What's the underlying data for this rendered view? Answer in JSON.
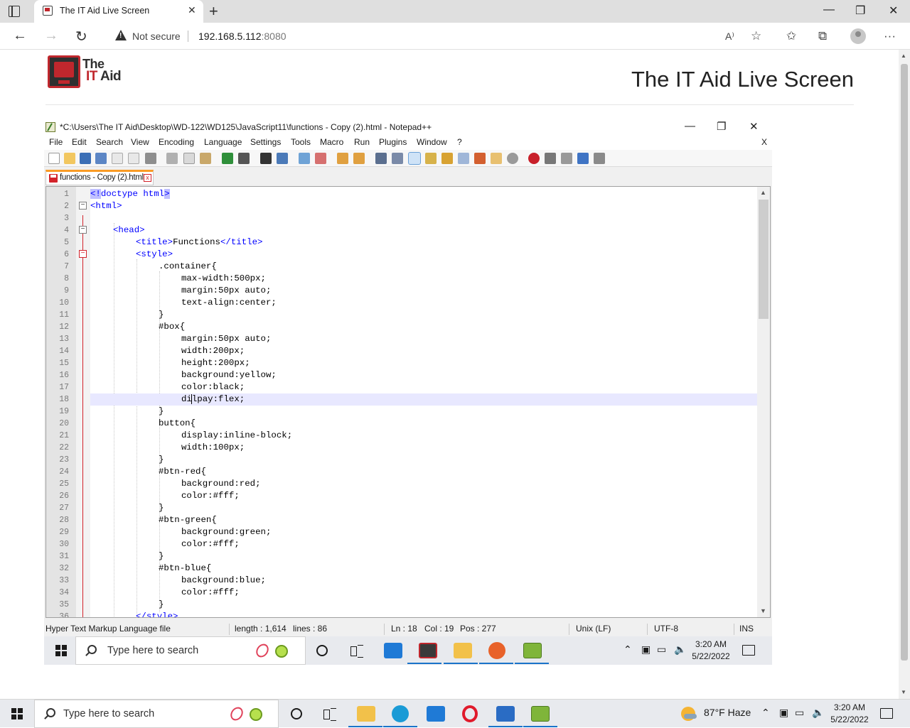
{
  "browser": {
    "tab_title": "The IT Aid Live Screen",
    "tab_close": "✕",
    "new_tab": "+",
    "not_secure": "Not secure",
    "url_host": "192.168.5.112",
    "url_port": ":8080",
    "minimize": "—",
    "restore": "❐",
    "close": "✕"
  },
  "page": {
    "logo_line1": "The",
    "logo_line2_a": "IT",
    "logo_line2_b": "Aid",
    "heading": "The IT Aid Live Screen"
  },
  "npp": {
    "title": "*C:\\Users\\The IT Aid\\Desktop\\WD-122\\WD125\\JavaScript11\\functions - Copy (2).html - Notepad++",
    "window_min": "—",
    "window_restore": "❐",
    "window_close": "✕",
    "menu": [
      "File",
      "Edit",
      "Search",
      "View",
      "Encoding",
      "Language",
      "Settings",
      "Tools",
      "Macro",
      "Run",
      "Plugins",
      "Window",
      "?"
    ],
    "menu_close": "X",
    "doc_tab": "functions - Copy (2).html",
    "doc_tab_close": "x",
    "status": {
      "file_type": "Hyper Text Markup Language file",
      "length": "length : 1,614",
      "lines": "lines : 86",
      "ln": "Ln : 18",
      "col": "Col : 19",
      "pos": "Pos : 277",
      "eol": "Unix (LF)",
      "encoding": "UTF-8",
      "mode": "INS"
    }
  },
  "code": {
    "line_numbers": [
      "1",
      "2",
      "3",
      "4",
      "5",
      "6",
      "7",
      "8",
      "9",
      "10",
      "11",
      "12",
      "13",
      "14",
      "15",
      "16",
      "17",
      "18",
      "19",
      "20",
      "21",
      "22",
      "23",
      "24",
      "25",
      "26",
      "27",
      "28",
      "29",
      "30",
      "31",
      "32",
      "33",
      "34",
      "35",
      "36"
    ],
    "l1_a": "<!",
    "l1_b": "doctype html",
    "l1_c": ">",
    "l2": "<html>",
    "l4": "<head>",
    "l5_a": "<title>",
    "l5_b": "Functions",
    "l5_c": "</title>",
    "l6": "<style>",
    "l7": ".container{",
    "l8": "max-width:500px;",
    "l9": "margin:50px auto;",
    "l10": "text-align:center;",
    "l11": "}",
    "l12": "#box{",
    "l13": "margin:50px auto;",
    "l14": "width:200px;",
    "l15": "height:200px;",
    "l16": "background:yellow;",
    "l17": "color:black;",
    "l18_a": "di",
    "l18_b": "lpay:flex;",
    "l19": "}",
    "l20": "button{",
    "l21": "display:inline-block;",
    "l22": "width:100px;",
    "l23": "}",
    "l24": "#btn-red{",
    "l25": "background:red;",
    "l26": "color:#fff;",
    "l27": "}",
    "l28": "#btn-green{",
    "l29": "background:green;",
    "l30": "color:#fff;",
    "l31": "}",
    "l32": "#btn-blue{",
    "l33": "background:blue;",
    "l34": "color:#fff;",
    "l35": "}",
    "l36": "</style>"
  },
  "remote_taskbar": {
    "search_placeholder": "Type here to search",
    "time": "3:20 AM",
    "date": "5/22/2022"
  },
  "taskbar": {
    "search_placeholder": "Type here to search",
    "weather": "87°F  Haze",
    "time": "3:20 AM",
    "date": "5/22/2022"
  },
  "colors": {
    "accent_red": "#c0272d",
    "tag_blue": "#0000ff",
    "current_line": "#e8e8ff",
    "tab_orange": "#fa9b25"
  },
  "icons": [
    "back-icon",
    "forward-icon",
    "refresh-icon",
    "warning-icon",
    "read-aloud-icon",
    "add-favorite-icon",
    "favorites-icon",
    "collections-icon",
    "profile-icon",
    "more-icon",
    "windows-start-icon",
    "search-icon",
    "cortana-icon",
    "task-view-icon",
    "mail-icon",
    "file-explorer-icon",
    "firefox-icon",
    "notepadpp-icon",
    "edge-icon",
    "opera-icon",
    "photos-icon",
    "chevron-up-icon",
    "network-icon",
    "volume-icon",
    "notification-icon"
  ]
}
